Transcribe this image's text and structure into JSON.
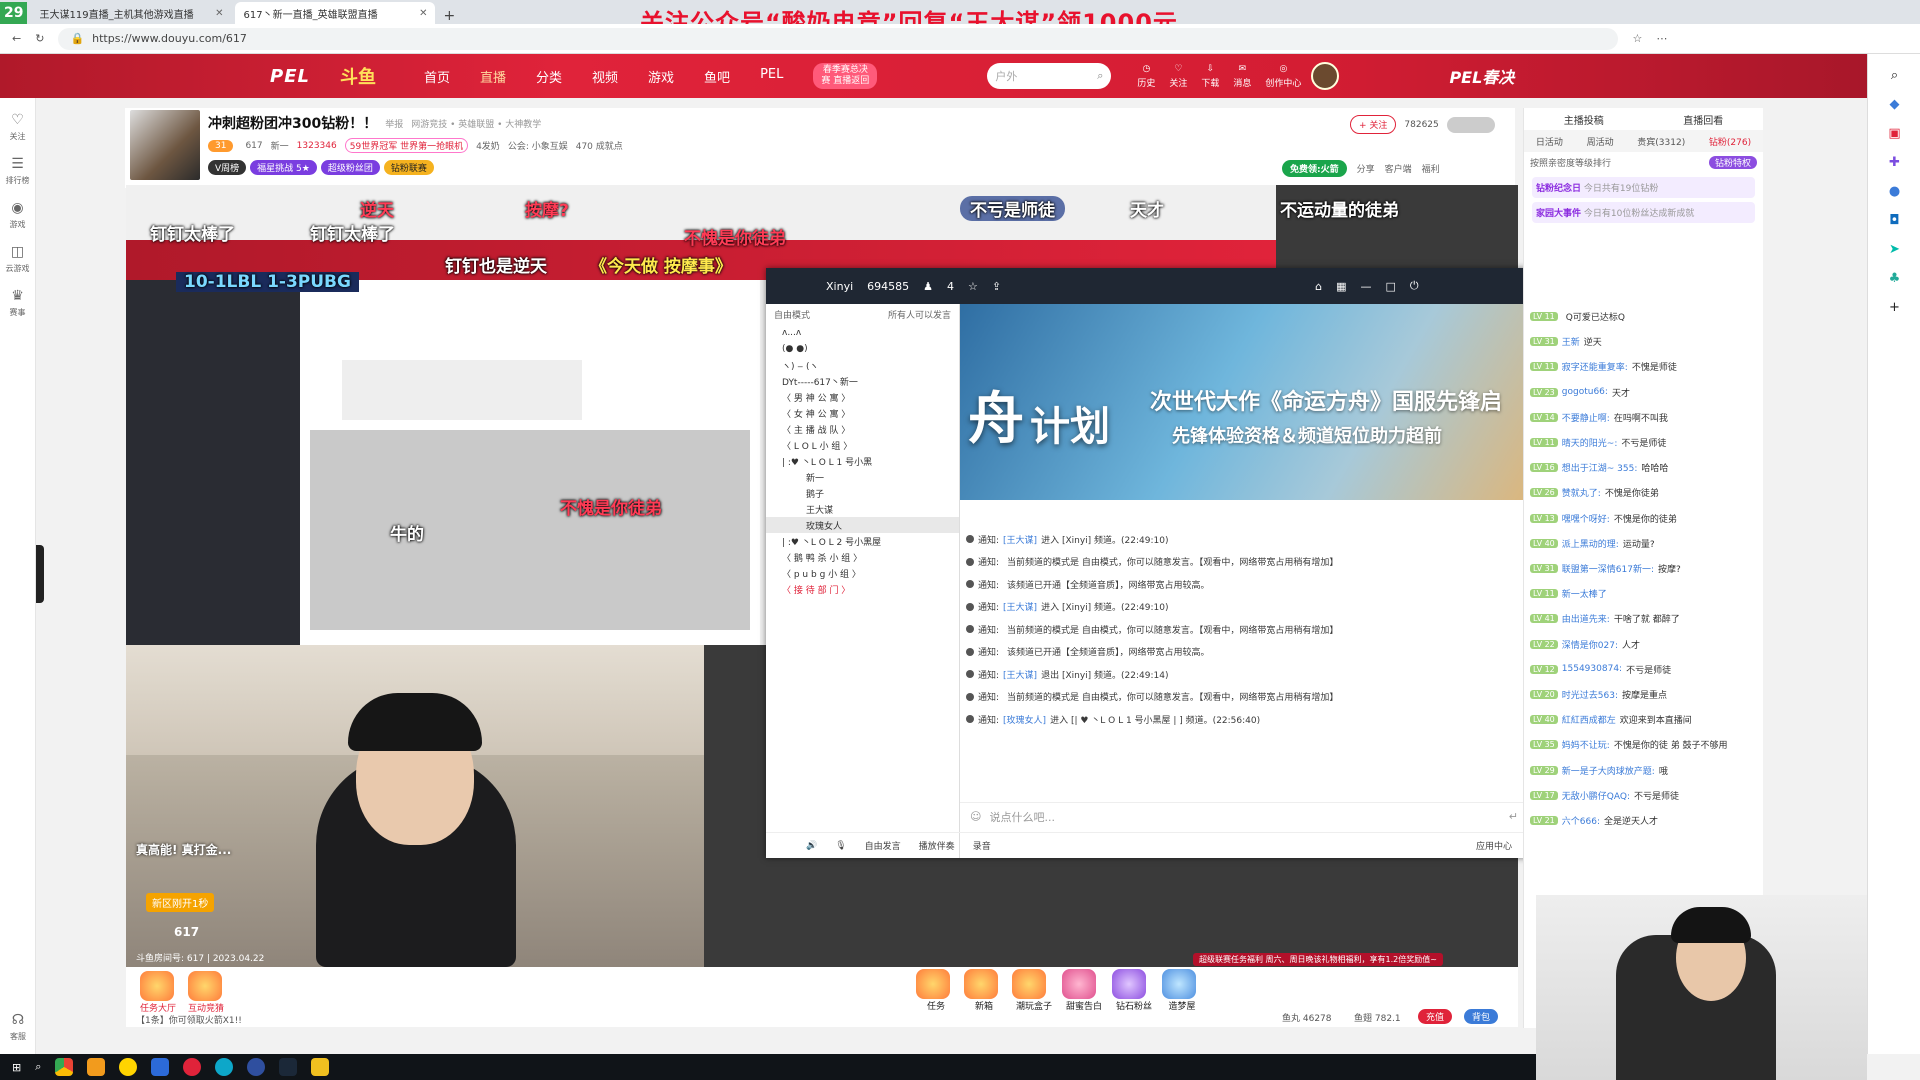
{
  "browser": {
    "tabs": [
      {
        "label": "王大谋119直播_主机其他游戏直播",
        "active": false
      },
      {
        "label": "617丶新一直播_英雄联盟直播",
        "active": true
      }
    ],
    "new_tab": "+",
    "url": "https://www.douyu.com/617",
    "tab_counter": "29"
  },
  "banner": "关注公众号“酸奶电竞”回复“王大谋”领1000元",
  "header": {
    "logo": "PEL",
    "site": "斗鱼",
    "nav": [
      "首页",
      "直播",
      "分类",
      "视频",
      "游戏",
      "鱼吧",
      "PEL"
    ],
    "nav_current": "直播",
    "promo": "春季赛总决赛 直播返回",
    "search_placeholder": "户外",
    "icons": [
      "历史",
      "关注",
      "下载",
      "消息",
      "创作中心"
    ],
    "right_logo": "PEL春决"
  },
  "left_rail": [
    "关注",
    "排行榜",
    "游戏",
    "云游戏",
    "赛事",
    "客服"
  ],
  "room": {
    "title": "冲刺超粉团冲300钻粉！！",
    "report": "举报",
    "category": "网游竞技 • 英雄联盟 • 大神教学",
    "lv": "31",
    "id": "617",
    "name": "新一",
    "hot": "1323346",
    "rank": "59世界冠军 世界第一抢眼机",
    "guild": "4发奶",
    "union": "公会: 小象互娱",
    "value": "470 成就点",
    "tags": [
      "V周榜",
      "福星挑战 5★",
      "超级粉丝团",
      "钻粉联赛"
    ],
    "follow": "+ 关注",
    "fans": "782625",
    "free_gift": "免费领:火箭",
    "share": "分享",
    "client": "客户端",
    "welfare": "福利"
  },
  "danmu": [
    "钉钉太棒了",
    "钉钉太棒了",
    "不愧是你徒弟",
    "逆天",
    "按摩?",
    "不亏是师徒",
    "天才",
    "不运动量的徒弟",
    "牛的",
    "10-1LBL 1-3PUBG",
    "钉钉也是逆天",
    "《今天做 按摩事》",
    "不愧是你徒弟"
  ],
  "yy": {
    "channel": "Xinyi",
    "id": "694585",
    "count": "4",
    "mode": "自由模式",
    "mode_note": "所有人可以发言",
    "tree": [
      " ʌ...ʌ",
      "(●  ●)",
      "ヽ) ‒ (ヽ",
      "DYt-----617丶新一",
      "〈 男 神 公 寓 〉",
      "〈 女 神 公 寓 〉",
      "〈 主 播 战 队 〉",
      "〈 L O L 小 组 〉",
      "| :♥ 丶L O L 1 号小黑",
      "新一",
      "鹅子",
      "王大谋",
      "玫瑰女人",
      "| :♥ 丶L O L 2 号小黑屋",
      "〈 鹅 鸭 杀 小 组 〉",
      "〈 p u b g 小 组 〉",
      "〈 接 待 部 门 〉"
    ],
    "banner_big": "舟",
    "banner_side": "计划",
    "banner_line1": "次世代大作《命运方舟》国服先锋启",
    "banner_line2": "先锋体验资格＆频道短位助力超前",
    "log": [
      {
        "pre": "通知:",
        "link": "[王大谋]",
        "text": "进入 [Xinyi] 频道。(22:49:10)"
      },
      {
        "pre": "通知:",
        "link": "",
        "text": "当前频道的模式是 自由模式，你可以随意发言。【观看中，网络带宽占用稍有增加】"
      },
      {
        "pre": "通知:",
        "link": "",
        "text": "该频道已开通【全频道音质】，网络带宽占用较高。"
      },
      {
        "pre": "通知:",
        "link": "[王大谋]",
        "text": "进入 [Xinyi] 频道。(22:49:10)"
      },
      {
        "pre": "通知:",
        "link": "",
        "text": "当前频道的模式是 自由模式，你可以随意发言。【观看中，网络带宽占用稍有增加】"
      },
      {
        "pre": "通知:",
        "link": "",
        "text": "该频道已开通【全频道音质】，网络带宽占用较高。"
      },
      {
        "pre": "通知:",
        "link": "[王大谋]",
        "text": "退出 [Xinyi] 频道。(22:49:14)"
      },
      {
        "pre": "通知:",
        "link": "",
        "text": "当前频道的模式是 自由模式，你可以随意发言。【观看中，网络带宽占用稍有增加】"
      },
      {
        "pre": "通知:",
        "link": "[玫瑰女人]",
        "text": "进入 [| ♥ 丶L O L 1 号小黑屋 | ] 频道。(22:56:40)"
      }
    ],
    "input_placeholder": "说点什么吧...",
    "bottom": [
      "自由发言",
      "播放伴奏",
      "录音",
      "应用中心"
    ]
  },
  "cam_overlay": {
    "title": "真高能! 真打金...",
    "btn": "新区刚开1秒",
    "id": "617",
    "bottom": "斗鱼房间号: 617 | 2023.04.22"
  },
  "giftbar": {
    "task": "任务大厅",
    "interact": "互动竞猜",
    "chat_tip": "【1条】你可领取火箭X1!!",
    "items": [
      "任务",
      "新箱",
      "潮玩盒子",
      "甜蜜告白",
      "钻石粉丝",
      "造梦屋"
    ],
    "fish": "鱼丸 46278",
    "fishbar": "鱼翅 782.1",
    "charge": "充值",
    "pack": "背包",
    "notice": "超级联赛任务福利 周六、周日晚该礼物相福利，享有1.2倍奖励值~"
  },
  "panel": {
    "tabs_top": [
      "主播投稿",
      "直播回看"
    ],
    "tabs": [
      "日活动",
      "周活动",
      "贵宾(3312)",
      "钻粉(276)"
    ],
    "note": "按照亲密度等级排行",
    "badge": "钻粉特权",
    "events": [
      {
        "title": "钻粉纪念日",
        "text": "今日共有19位钻粉"
      },
      {
        "title": "家园大事件",
        "text": "今日有10位粉丝达成新成就"
      }
    ],
    "chat": [
      {
        "lv": "LV 11",
        "nick": "",
        "text": "Q可爱已达标Q"
      },
      {
        "lv": "LV 31",
        "nick": "王新",
        "text": "逆天"
      },
      {
        "lv": "LV 11",
        "nick": "寂字还能重复率:",
        "text": "不愧是师徒"
      },
      {
        "lv": "LV 23",
        "nick": "gogotu66:",
        "text": "天才"
      },
      {
        "lv": "LV 14",
        "nick": "不要静止啊:",
        "text": "在吗啊不叫我"
      },
      {
        "lv": "LV 11",
        "nick": "晴天的阳光~:",
        "text": "不亏是师徒"
      },
      {
        "lv": "LV 16",
        "nick": "想出于江湖~ 355:",
        "text": "哈哈哈"
      },
      {
        "lv": "LV 26",
        "nick": "赞就丸了:",
        "text": "不愧是你徒弟"
      },
      {
        "lv": "LV 13",
        "nick": "嘿嘿个呀好:",
        "text": "不愧是你的徒弟"
      },
      {
        "lv": "LV 40",
        "nick": "派上黑动的理:",
        "text": "运动量?"
      },
      {
        "lv": "LV 31",
        "nick": "联盟第一深情617新一:",
        "text": "按摩?"
      },
      {
        "lv": "LV 11",
        "nick": "新一太棒了",
        "text": ""
      },
      {
        "lv": "LV 41",
        "nick": "由出道先来:",
        "text": "干啥了就 都醉了"
      },
      {
        "lv": "LV 22",
        "nick": "深情是你027:",
        "text": "人才"
      },
      {
        "lv": "LV 12",
        "nick": "1554930874:",
        "text": "不亏是师徒"
      },
      {
        "lv": "LV 20",
        "nick": "时光过去563:",
        "text": "按摩是重点"
      },
      {
        "lv": "LV 40",
        "nick": "紅紅西成都左",
        "text": "欢迎来到本直播间"
      },
      {
        "lv": "LV 35",
        "nick": "妈妈不让玩:",
        "text": "不愧是你的徒 弟 鼓子不够用"
      },
      {
        "lv": "LV 29",
        "nick": "新一是子大肉球放产题:",
        "text": "哦"
      },
      {
        "lv": "LV 17",
        "nick": "无敌小鹏仔QAQ:",
        "text": "不亏是师徒"
      },
      {
        "lv": "LV 21",
        "nick": "六个666:",
        "text": "全是逆天人才"
      }
    ]
  },
  "colors": {
    "brand": "#e0233a",
    "danmu_red": "#ff3b55",
    "link": "#3b7bd8"
  }
}
